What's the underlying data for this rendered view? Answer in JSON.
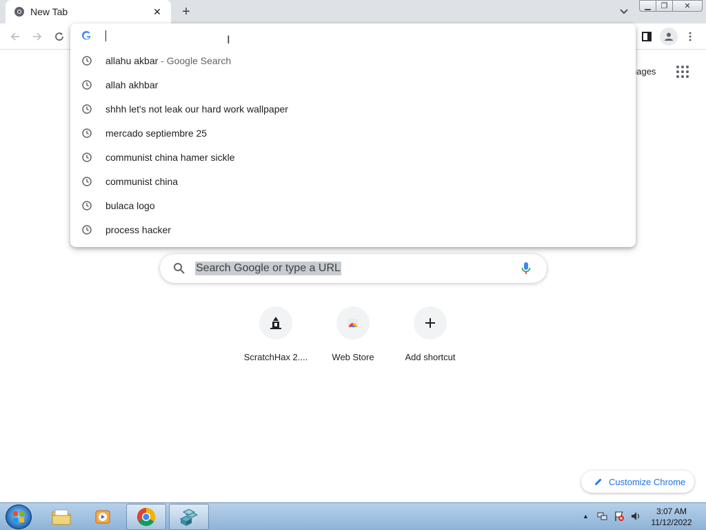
{
  "tab": {
    "title": "New Tab"
  },
  "omnibox": {
    "value": ""
  },
  "suggestions": [
    {
      "text": "allahu akbar",
      "desc": " - Google Search"
    },
    {
      "text": "allah akhbar",
      "desc": ""
    },
    {
      "text": "shhh let's not leak our hard work wallpaper",
      "desc": ""
    },
    {
      "text": "mercado septiembre 25",
      "desc": ""
    },
    {
      "text": "communist china hamer sickle",
      "desc": ""
    },
    {
      "text": "communist china",
      "desc": ""
    },
    {
      "text": "bulaca logo",
      "desc": ""
    },
    {
      "text": "process hacker",
      "desc": ""
    }
  ],
  "ntp": {
    "images_link": "nages",
    "search_placeholder": "Search Google or type a URL",
    "shortcuts": [
      {
        "label": "ScratchHax 2....",
        "icon": "scratchhax-icon"
      },
      {
        "label": "Web Store",
        "icon": "web-store-icon"
      },
      {
        "label": "Add shortcut",
        "icon": "plus-icon"
      }
    ],
    "customize_label": "Customize Chrome"
  },
  "taskbar": {
    "time": "3:07 AM",
    "date": "11/12/2022",
    "apps": [
      "file-explorer",
      "media-player",
      "chrome",
      "registry-editor"
    ]
  },
  "colors": {
    "accent": "#1a73e8",
    "tabstrip": "#dee1e6"
  }
}
